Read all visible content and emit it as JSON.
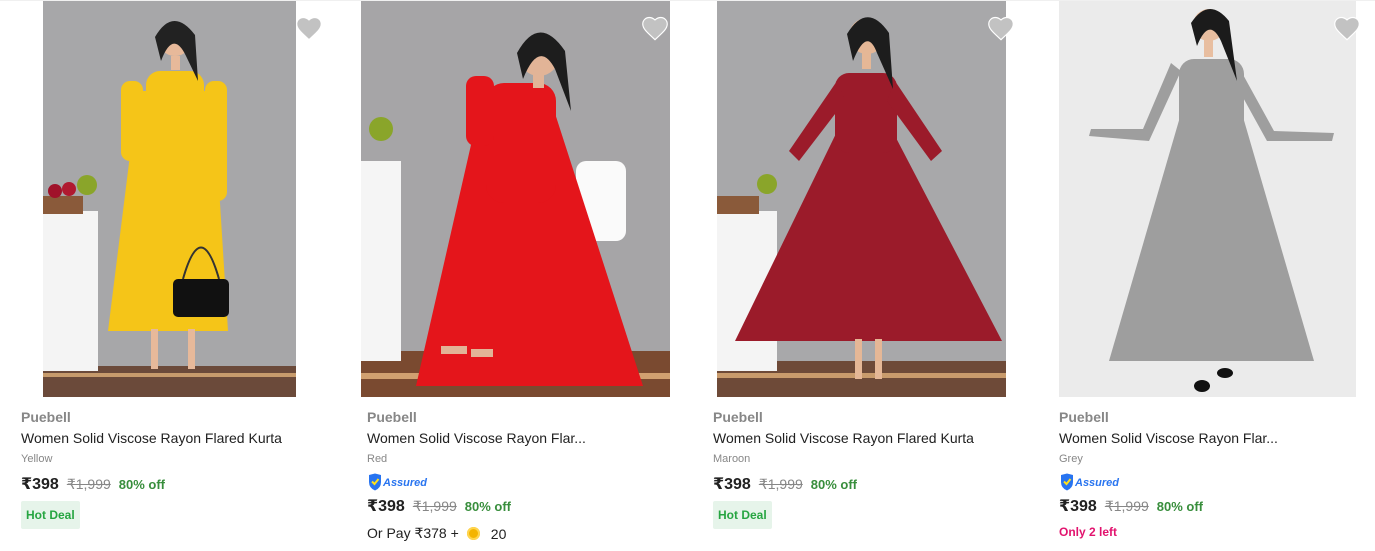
{
  "products": [
    {
      "brand": "Puebell",
      "title": "Women Solid Viscose Rayon Flared Kurta",
      "color_name": "Yellow",
      "price": "₹398",
      "mrp": "₹1,999",
      "discount": "80% off",
      "deal_badge": "Hot Deal",
      "dress_color": "#f5c518",
      "image_alt": "Woman in yellow flared kurta"
    },
    {
      "brand": "Puebell",
      "title": "Women Solid Viscose Rayon Flar...",
      "color_name": "Red",
      "assured_label": "Assured",
      "price": "₹398",
      "mrp": "₹1,999",
      "discount": "80% off",
      "pay_text": "Or Pay ₹378 +",
      "pay_coins": "20",
      "dress_color": "#e4151b",
      "image_alt": "Woman in red flared kurta"
    },
    {
      "brand": "Puebell",
      "title": "Women Solid Viscose Rayon Flared Kurta",
      "color_name": "Maroon",
      "price": "₹398",
      "mrp": "₹1,999",
      "discount": "80% off",
      "deal_badge": "Hot Deal",
      "dress_color": "#9b1b2a",
      "image_alt": "Woman in maroon flared kurta"
    },
    {
      "brand": "Puebell",
      "title": "Women Solid Viscose Rayon Flar...",
      "color_name": "Grey",
      "assured_label": "Assured",
      "price": "₹398",
      "mrp": "₹1,999",
      "discount": "80% off",
      "stock_text": "Only 2 left",
      "dress_color": "#9e9e9e",
      "image_alt": "Woman in grey flared kurta"
    }
  ],
  "icons": {
    "wishlist": "heart-icon",
    "assured": "shield-icon",
    "coin": "supercoin-icon"
  },
  "colors": {
    "discount": "#388e3c",
    "hot_deal_bg": "#e6f4ea",
    "stock_warning": "#e2136e",
    "assured_blue": "#2874f0"
  }
}
